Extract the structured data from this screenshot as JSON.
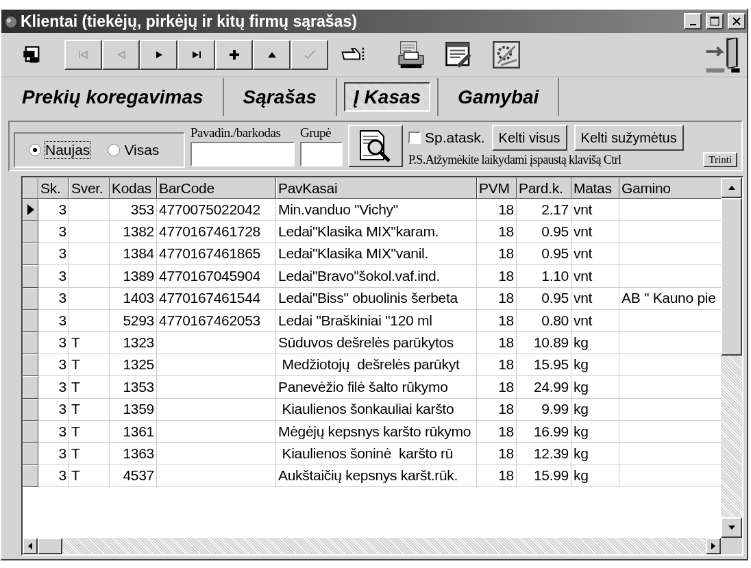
{
  "window": {
    "title": "Klientai (tiekėjų, pirkėjų ir kitų firmų sąrašas)"
  },
  "toolbar": [
    {
      "kind": "first",
      "disabled": true
    },
    {
      "kind": "prev",
      "disabled": true
    },
    {
      "kind": "next",
      "disabled": false
    },
    {
      "kind": "last",
      "disabled": false
    },
    {
      "kind": "add",
      "disabled": false
    },
    {
      "kind": "up",
      "disabled": false
    },
    {
      "kind": "confirm",
      "disabled": true
    }
  ],
  "tabs": [
    {
      "label": "Prekių koregavimas",
      "selected": false
    },
    {
      "label": "Sąrašas",
      "selected": false
    },
    {
      "label": "Į Kasas",
      "selected": true
    },
    {
      "label": "Gamybai",
      "selected": false
    }
  ],
  "filter": {
    "radios": [
      {
        "label": "Naujas",
        "selected": true
      },
      {
        "label": "Visas",
        "selected": false
      }
    ],
    "name_label": "Pavadin./barkodas",
    "group_label": "Grupė",
    "checkbox": {
      "label": "Sp.atask.",
      "checked": false
    },
    "buttons": [
      "Kelti visus",
      "Kelti sužymėtus"
    ],
    "note": "P.S.Atžymėkite laikydami įspaustą klavišą Ctrl",
    "delete_button": "Trinti"
  },
  "table": {
    "columns": [
      "Sk.",
      "Sver.",
      "Kodas",
      "BarCode",
      "PavKasai",
      "PVM",
      "Pard.k.",
      "Matas",
      "Gamino"
    ],
    "rows": [
      {
        "current": true,
        "sk": "3",
        "kodas": "353",
        "barcode": "4770075022042",
        "name": "Min.vanduo \"Vichy\"",
        "pvm": "18",
        "price": "2.17",
        "unit": "vnt"
      },
      {
        "current": false,
        "sk": "3",
        "kodas": "1382",
        "barcode": "4770167461728",
        "name": "Ledai\"Klasika MIX\"karam.",
        "pvm": "18",
        "price": "0.95",
        "unit": "vnt"
      },
      {
        "current": false,
        "sk": "3",
        "kodas": "1384",
        "barcode": "4770167461865",
        "name": "Ledai\"Klasika MIX\"vanil.",
        "pvm": "18",
        "price": "0.95",
        "unit": "vnt"
      },
      {
        "current": false,
        "sk": "3",
        "kodas": "1389",
        "barcode": "4770167045904",
        "name": "Ledai\"Bravo\"šokol.vaf.ind.",
        "pvm": "18",
        "price": "1.10",
        "unit": "vnt"
      },
      {
        "current": false,
        "sk": "3",
        "kodas": "1403",
        "barcode": "4770167461544",
        "name": "Ledai\"Biss\" obuolinis šerbeta",
        "pvm": "18",
        "price": "0.95",
        "unit": "vnt",
        "maker": "AB \" Kauno pie"
      },
      {
        "current": false,
        "sk": "3",
        "kodas": "5293",
        "barcode": "4770167462053",
        "name": "Ledai \"Braškiniai \"120 ml",
        "pvm": "18",
        "price": "0.80",
        "unit": "vnt"
      },
      {
        "current": false,
        "sk": "3",
        "sver": "T",
        "kodas": "1323",
        "name": "Sūduvos dešrelės parūkytos",
        "pvm": "18",
        "price": "10.89",
        "unit": "kg"
      },
      {
        "current": false,
        "sk": "3",
        "sver": "T",
        "kodas": "1325",
        "name": " Medžiotojų  dešrelės parūkyt",
        "pvm": "18",
        "price": "15.95",
        "unit": "kg"
      },
      {
        "current": false,
        "sk": "3",
        "sver": "T",
        "kodas": "1353",
        "name": "Panevėžio filė šalto rūkymo",
        "pvm": "18",
        "price": "24.99",
        "unit": "kg"
      },
      {
        "current": false,
        "sk": "3",
        "sver": "T",
        "kodas": "1359",
        "name": " Kiaulienos šonkauliai karšto",
        "pvm": "18",
        "price": "9.99",
        "unit": "kg"
      },
      {
        "current": false,
        "sk": "3",
        "sver": "T",
        "kodas": "1361",
        "name": "Mėgėjų kepsnys karšto rūkymo",
        "pvm": "18",
        "price": "16.99",
        "unit": "kg"
      },
      {
        "current": false,
        "sk": "3",
        "sver": "T",
        "kodas": "1363",
        "name": " Kiaulienos šoninė  karšto rū",
        "pvm": "18",
        "price": "12.39",
        "unit": "kg"
      },
      {
        "current": false,
        "sk": "3",
        "sver": "T",
        "kodas": "4537",
        "name": "Aukštaičių kepsnys karšt.rūk.",
        "pvm": "18",
        "price": "15.99",
        "unit": "kg"
      }
    ]
  }
}
